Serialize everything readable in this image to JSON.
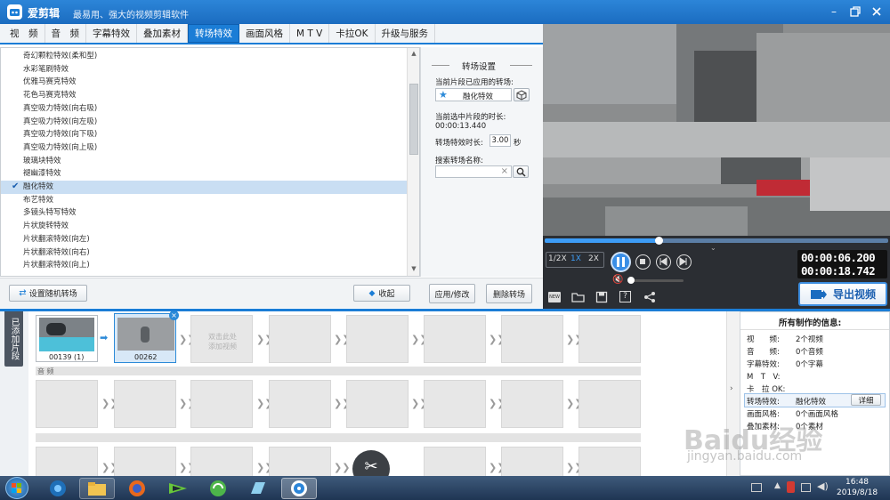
{
  "app": {
    "name": "爱剪辑",
    "slogan": "最易用、强大的视频剪辑软件"
  },
  "colors": {
    "accent": "#1b7dd6",
    "selection": "#c9def3",
    "video_bg": "#8d8f90",
    "taskbar": "#1f3553"
  },
  "tabs": [
    {
      "label": "视　频",
      "active": false
    },
    {
      "label": "音　频",
      "active": false
    },
    {
      "label": "字幕特效",
      "active": false
    },
    {
      "label": "叠加素材",
      "active": false
    },
    {
      "label": "转场特效",
      "active": true
    },
    {
      "label": "画面风格",
      "active": false
    },
    {
      "label": "M T V",
      "active": false
    },
    {
      "label": "卡拉OK",
      "active": false
    },
    {
      "label": "升级与服务",
      "active": false
    }
  ],
  "transitions": {
    "items": [
      "奇幻颗粒特效(柔和型)",
      "水彩笔刷特效",
      "优雅马赛克特效",
      "花色马赛克特效",
      "真空吸力特效(向右吸)",
      "真空吸力特效(向左吸)",
      "真空吸力特效(向下吸)",
      "真空吸力特效(向上吸)",
      "玻璃块特效",
      "褪幽漆特效",
      "融化特效",
      "布艺特效",
      "多镜头特写特效",
      "片状旋转特效",
      "片状翻滚特效(向左)",
      "片状翻滚特效(向右)",
      "片状翻滚特效(向上)"
    ],
    "selected_index": 10,
    "check_icon": "checkmark-icon"
  },
  "buttons": {
    "random": "设置随机转场",
    "collapse": "收起",
    "apply": "应用/修改",
    "delete": "删除转场"
  },
  "settings": {
    "title": "转场设置",
    "applied_label": "当前片段已应用的转场:",
    "applied_value": "融化特效",
    "duration_label": "当前选中片段的时长:",
    "duration_value": "00:00:13.440",
    "effect_time_label": "转场特效时长:",
    "effect_time_value": "3.00",
    "effect_time_unit": "秒",
    "search_label": "搜索转场名称:",
    "search_value": ""
  },
  "player": {
    "speeds": [
      "1/2X",
      "1X",
      "2X"
    ],
    "active_speed": "1X",
    "current_time": "00:00:06.200",
    "total_time": "00:00:18.742",
    "progress": 0.33,
    "volume": 0.0,
    "export": "导出视频"
  },
  "timeline": {
    "side_label": "已添加片段",
    "clips": [
      {
        "label": "00139 (1)"
      },
      {
        "label": "00262"
      }
    ],
    "placeholder": "双击此处\n添加视频",
    "audio_label": "音 频"
  },
  "info": {
    "title": "所有制作的信息:",
    "rows": [
      {
        "key": "视　　频:",
        "value": "2个视频"
      },
      {
        "key": "音　　频:",
        "value": "0个音频"
      },
      {
        "key": "字幕特效:",
        "value": "0个字幕"
      },
      {
        "key": "M　T　V:",
        "value": ""
      },
      {
        "key": "卡　拉 OK:",
        "value": ""
      },
      {
        "key": "转场特效:",
        "value": "融化特效"
      },
      {
        "key": "画面风格:",
        "value": "0个画面风格"
      },
      {
        "key": "叠加素材:",
        "value": "0个素材"
      }
    ],
    "detail": "详细"
  },
  "taskbar": {
    "time": "16:48",
    "date": "2019/8/18"
  },
  "watermark": {
    "text": "Baidu经验",
    "url": "jingyan.baidu.com"
  }
}
